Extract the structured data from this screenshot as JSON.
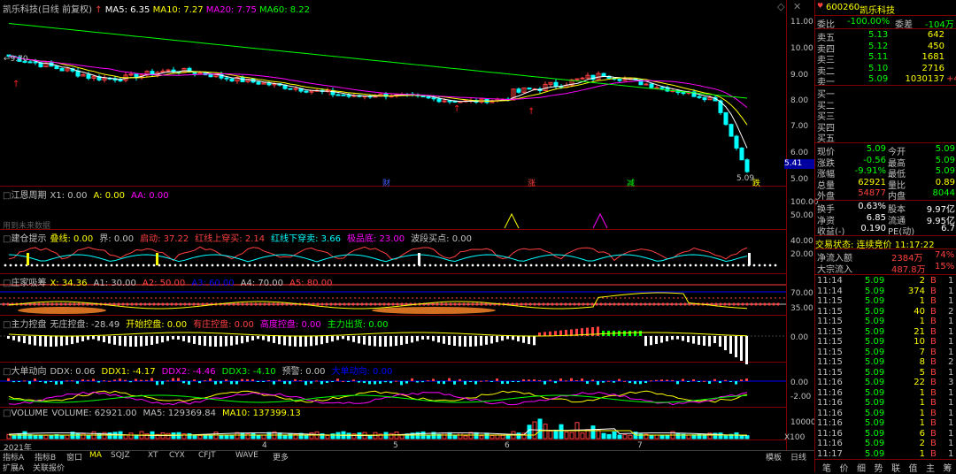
{
  "header": {
    "stock": "凯乐科技",
    "mode": "(日线 前复权)",
    "ma5": "MA5: 6.35",
    "ma10": "MA10: 7.27",
    "ma20": "MA20: 7.75",
    "ma60": "MA60: 8.22",
    "start_price": "9.70"
  },
  "price_axis": [
    "11.00",
    "10.00",
    "9.00",
    "8.00",
    "7.00",
    "6.00",
    "5.00"
  ],
  "price_markers": {
    "current": "5.41",
    "low": "5.09",
    "tags": [
      "财",
      "涨",
      "减",
      "跌"
    ]
  },
  "panels": [
    {
      "title": "江恩周期",
      "params": [
        {
          "t": "X1: 0.00",
          "c": "#c0c0c0"
        },
        {
          "t": "A: 0.00",
          "c": "#ffff00"
        },
        {
          "t": "AA: 0.00",
          "c": "#ff00ff"
        }
      ],
      "axis": [
        "100.00",
        "50.00"
      ],
      "note": "用到未来数据"
    },
    {
      "title": "建仓提示",
      "params": [
        {
          "t": "叠线: 0.00",
          "c": "#ffff00"
        },
        {
          "t": "界: 0.00",
          "c": "#c0c0c0"
        },
        {
          "t": "启动: 37.22",
          "c": "#ff4040"
        },
        {
          "t": "红线上穿买: 2.14",
          "c": "#ff4040"
        },
        {
          "t": "红线下穿卖: 3.66",
          "c": "#00ffff"
        },
        {
          "t": "极品底: 23.00",
          "c": "#ff00ff"
        },
        {
          "t": "波段买点: 0.00",
          "c": "#c0c0c0"
        }
      ],
      "axis": [
        "40.00",
        "20.00"
      ]
    },
    {
      "title": "庄家吸筹",
      "params": [
        {
          "t": "X: 34.36",
          "c": "#ffff00"
        },
        {
          "t": "A1: 30.00",
          "c": "#c0c0c0"
        },
        {
          "t": "A2: 50.00",
          "c": "#ff4040"
        },
        {
          "t": "A3: 60.00",
          "c": "#0000ff"
        },
        {
          "t": "A4: 70.00",
          "c": "#c0c0c0"
        },
        {
          "t": "A5: 80.00",
          "c": "#ff4040"
        }
      ],
      "axis": [
        "70.00",
        "35.00"
      ]
    },
    {
      "title": "主力控盘",
      "params": [
        {
          "t": "无庄控盘: -28.49",
          "c": "#c0c0c0"
        },
        {
          "t": "开始控盘: 0.00",
          "c": "#ffff00"
        },
        {
          "t": "有庄控盘: 0.00",
          "c": "#ff4040"
        },
        {
          "t": "高度控盘: 0.00",
          "c": "#ff00ff"
        },
        {
          "t": "主力出货: 0.00",
          "c": "#00ff00"
        }
      ],
      "axis": [
        "0.00"
      ]
    },
    {
      "title": "大单动向",
      "params": [
        {
          "t": "DDX: 0.06",
          "c": "#c0c0c0"
        },
        {
          "t": "DDX1: -4.17",
          "c": "#ffff00"
        },
        {
          "t": "DDX2: -4.46",
          "c": "#ff00ff"
        },
        {
          "t": "DDX3: -4.10",
          "c": "#00ff00"
        },
        {
          "t": "预警: 0.00",
          "c": "#c0c0c0"
        },
        {
          "t": "大单动向: 0.00",
          "c": "#0000ff"
        }
      ],
      "axis": [
        "0.00",
        "-2.00"
      ]
    },
    {
      "title": "VOLUME",
      "params": [
        {
          "t": "VOLUME: 62921.00",
          "c": "#c0c0c0"
        },
        {
          "t": "MA5: 129369.84",
          "c": "#c0c0c0"
        },
        {
          "t": "MA10: 137399.13",
          "c": "#ffff00"
        }
      ],
      "axis": [
        "10000",
        "X100"
      ]
    }
  ],
  "date_axis": [
    "2021年",
    "4",
    "5",
    "6",
    "7"
  ],
  "bottom_tabs": [
    "指标A",
    "指标B",
    "窗口",
    "MA",
    "SQJZ",
    "XT",
    "CYX",
    "CFJT",
    "WAVE",
    "更多"
  ],
  "bottom_tabs2": [
    "扩展A",
    "关联报价"
  ],
  "bottom_right": [
    "模板",
    "日线"
  ],
  "quote": {
    "code": "600260",
    "name": "凯乐科技",
    "weibi": {
      "label": "委比",
      "value": "-100.00%",
      "label2": "委差",
      "value2": "-104万"
    },
    "asks": [
      {
        "label": "卖五",
        "price": "5.13",
        "vol": "642"
      },
      {
        "label": "卖四",
        "price": "5.12",
        "vol": "450"
      },
      {
        "label": "卖三",
        "price": "5.11",
        "vol": "1681"
      },
      {
        "label": "卖二",
        "price": "5.10",
        "vol": "2716"
      },
      {
        "label": "卖一",
        "price": "5.09",
        "vol": "1030137",
        "extra": "+4"
      }
    ],
    "bids": [
      "买一",
      "买二",
      "买三",
      "买四",
      "买五"
    ],
    "stats": [
      {
        "l1": "现价",
        "v1": "5.09",
        "l2": "今开",
        "v2": "5.09",
        "c1": "#00ff00",
        "c2": "#00ff00"
      },
      {
        "l1": "涨跌",
        "v1": "-0.56",
        "l2": "最高",
        "v2": "5.09",
        "c1": "#00ff00",
        "c2": "#00ff00"
      },
      {
        "l1": "涨幅",
        "v1": "-9.91%",
        "l2": "最低",
        "v2": "5.09",
        "c1": "#00ff00",
        "c2": "#00ff00"
      },
      {
        "l1": "总量",
        "v1": "62921",
        "l2": "量比",
        "v2": "0.89",
        "c1": "#ffff00",
        "c2": "#ffff00"
      },
      {
        "l1": "外盘",
        "v1": "54877",
        "l2": "内盘",
        "v2": "8044",
        "c1": "#ff4040",
        "c2": "#00ff00"
      }
    ],
    "stats2": [
      {
        "l1": "换手",
        "v1": "0.63%",
        "l2": "股本",
        "v2": "9.97亿"
      },
      {
        "l1": "净资",
        "v1": "6.85",
        "l2": "流通",
        "v2": "9.95亿"
      },
      {
        "l1": "收益(-)",
        "v1": "0.190",
        "l2": "PE(动)",
        "v2": "6.7"
      }
    ],
    "status": "交易状态: 连续竞价 11:17:22",
    "netflow": {
      "label": "净流入额",
      "value": "2384万",
      "pct": "74%"
    },
    "bigflow": {
      "label": "大宗流入",
      "value": "487.8万",
      "pct": "15%"
    },
    "ticks": [
      {
        "t": "11:14",
        "p": "5.09",
        "v": "2",
        "bs": "B",
        "n": "1"
      },
      {
        "t": "11:14",
        "p": "5.09",
        "v": "374",
        "bs": "B",
        "n": "1"
      },
      {
        "t": "11:15",
        "p": "5.09",
        "v": "1",
        "bs": "B",
        "n": "1"
      },
      {
        "t": "11:15",
        "p": "5.09",
        "v": "40",
        "bs": "B",
        "n": "2"
      },
      {
        "t": "11:15",
        "p": "5.09",
        "v": "1",
        "bs": "B",
        "n": "1"
      },
      {
        "t": "11:15",
        "p": "5.09",
        "v": "21",
        "bs": "B",
        "n": "1"
      },
      {
        "t": "11:15",
        "p": "5.09",
        "v": "10",
        "bs": "B",
        "n": "1"
      },
      {
        "t": "11:15",
        "p": "5.09",
        "v": "7",
        "bs": "B",
        "n": "1"
      },
      {
        "t": "11:15",
        "p": "5.09",
        "v": "8",
        "bs": "B",
        "n": "2"
      },
      {
        "t": "11:15",
        "p": "5.09",
        "v": "5",
        "bs": "B",
        "n": "1"
      },
      {
        "t": "11:16",
        "p": "5.09",
        "v": "22",
        "bs": "B",
        "n": "3"
      },
      {
        "t": "11:16",
        "p": "5.09",
        "v": "1",
        "bs": "B",
        "n": "1"
      },
      {
        "t": "11:16",
        "p": "5.09",
        "v": "1",
        "bs": "B",
        "n": "1"
      },
      {
        "t": "11:16",
        "p": "5.09",
        "v": "1",
        "bs": "B",
        "n": "1"
      },
      {
        "t": "11:16",
        "p": "5.09",
        "v": "1",
        "bs": "B",
        "n": "1"
      },
      {
        "t": "11:16",
        "p": "5.09",
        "v": "6",
        "bs": "B",
        "n": "1"
      },
      {
        "t": "11:16",
        "p": "5.09",
        "v": "2",
        "bs": "B",
        "n": "1"
      },
      {
        "t": "11:17",
        "p": "5.09",
        "v": "1",
        "bs": "B",
        "n": "1"
      }
    ],
    "tabs": [
      "笔",
      "价",
      "细",
      "势",
      "联",
      "值",
      "主",
      "筹"
    ]
  },
  "colors": {
    "up": "#ff4040",
    "down": "#00ffff",
    "border": "#800000",
    "ma5": "#ffffff",
    "ma10": "#ffff00",
    "ma20": "#ff00ff",
    "ma60": "#00ff00"
  }
}
